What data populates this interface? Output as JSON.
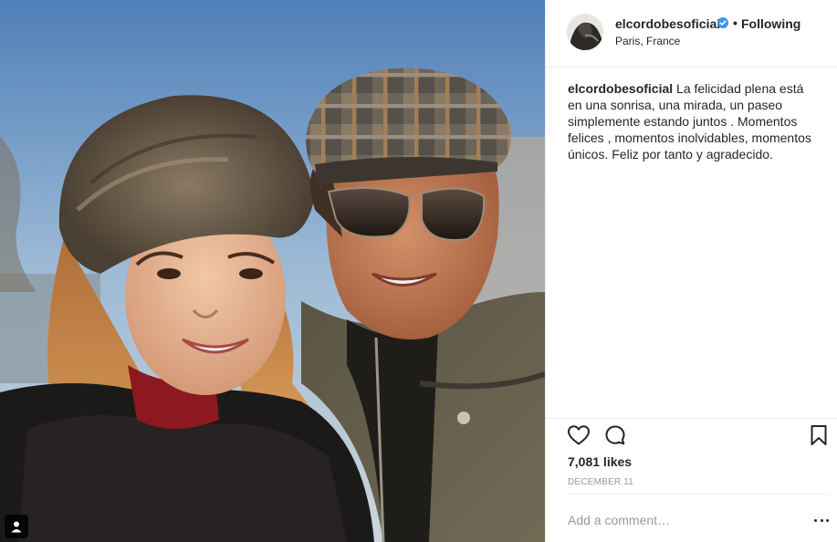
{
  "post": {
    "username": "elcordobesoficial",
    "verified": true,
    "separator": "•",
    "follow_status": "Following",
    "location": "Paris, France",
    "caption_user": "elcordobesoficial",
    "caption_text": "La felicidad plena está en una sonrisa, una mirada, un paseo simplemente estando juntos . Momentos felices , momentos inolvidables, momentos únicos. Feliz por tanto y agradecido.",
    "likes": "7,081 likes",
    "date": "DECEMBER 11",
    "comment_placeholder": "Add a comment…"
  },
  "icons": {
    "verified": "verified-badge-icon",
    "like": "heart-icon",
    "comment": "comment-icon",
    "save": "bookmark-icon",
    "more": "more-options-icon",
    "tagged": "user-tag-icon"
  },
  "colors": {
    "text": "#262626",
    "muted": "#999999",
    "verified": "#3897f0",
    "divider": "#efefef"
  }
}
